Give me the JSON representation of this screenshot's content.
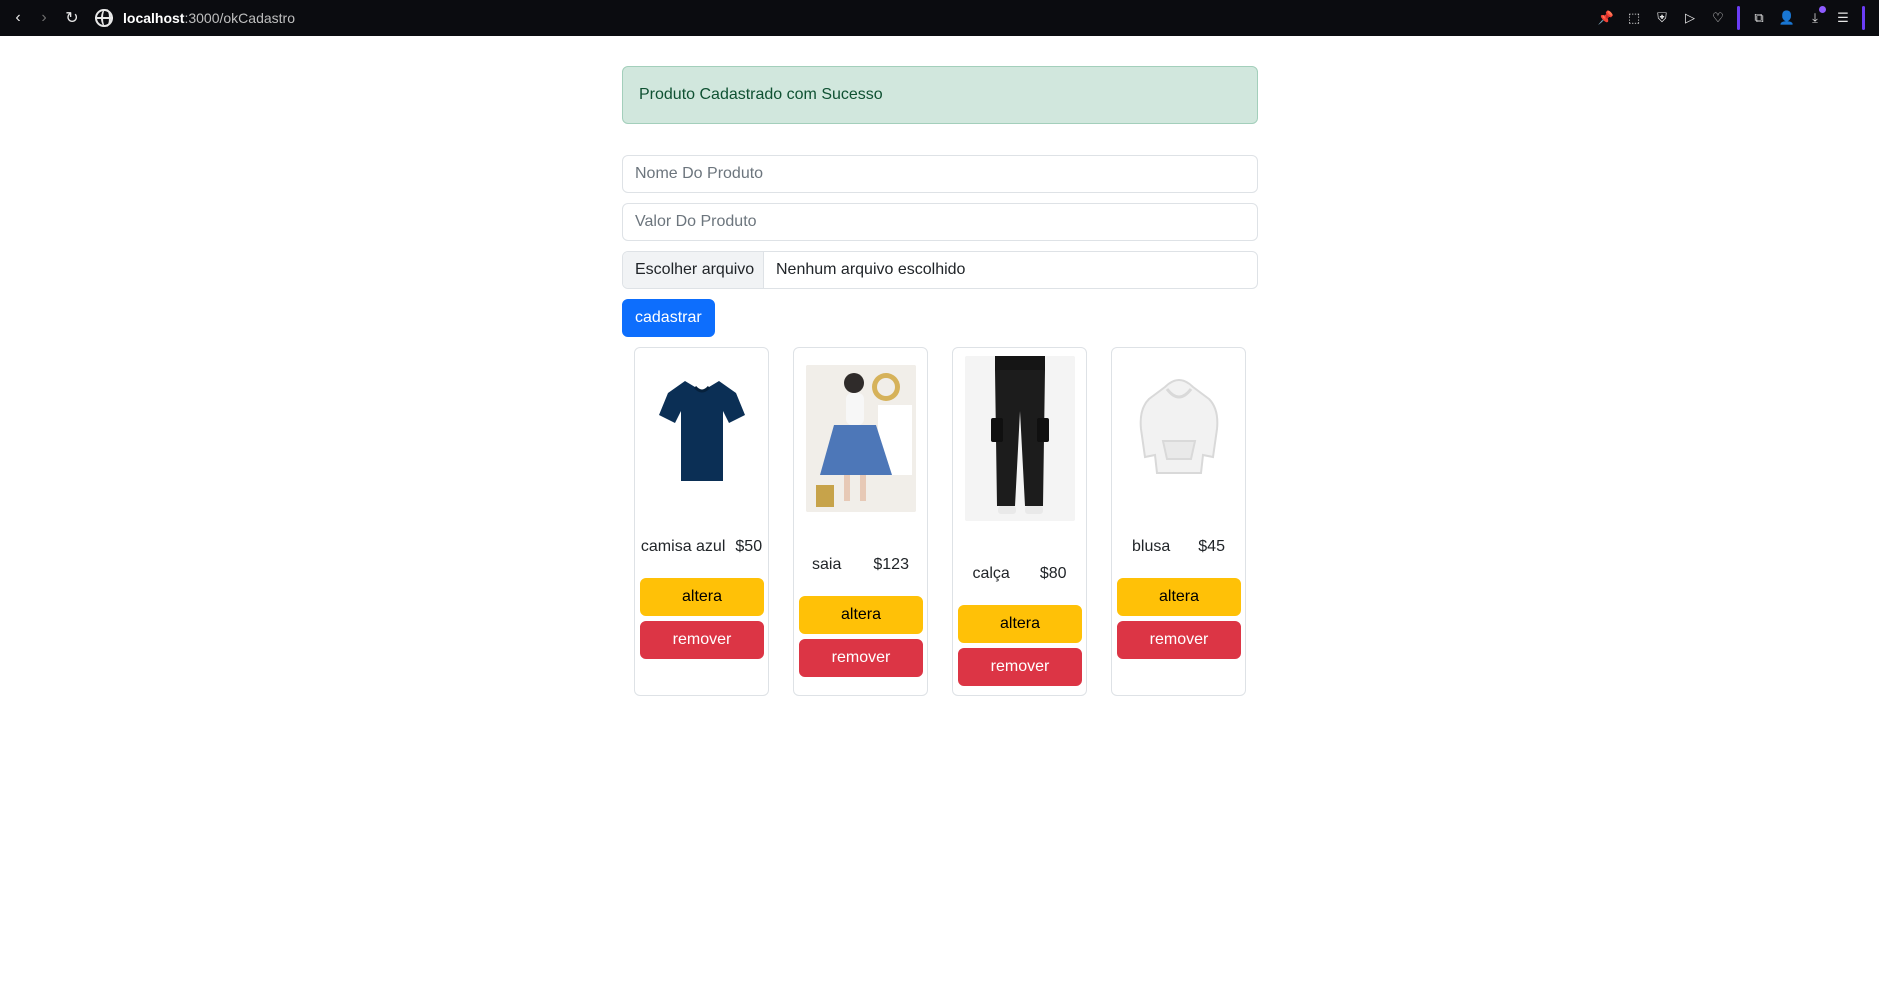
{
  "browser": {
    "url_host": "localhost",
    "url_rest": ":3000/okCadastro"
  },
  "alert": {
    "message": "Produto Cadastrado com Sucesso"
  },
  "form": {
    "name_placeholder": "Nome Do Produto",
    "value_placeholder": "Valor Do Produto",
    "file_button_label": "Escolher arquivo",
    "file_status": "Nenhum arquivo escolhido",
    "submit_label": "cadastrar"
  },
  "products": [
    {
      "name": "camisa azul",
      "price": "$50",
      "alter_label": "altera",
      "remove_label": "remover",
      "image_icon": "tshirt-icon",
      "colors": {
        "main": "#0b2f55",
        "shadow": "#06213c"
      }
    },
    {
      "name": "saia",
      "price": "$123",
      "alter_label": "altera",
      "remove_label": "remover",
      "image_icon": "skirt-photo",
      "colors": {
        "main": "#4d77b8",
        "accent": "#f0f0f0"
      }
    },
    {
      "name": "calça",
      "price": "$80",
      "alter_label": "altera",
      "remove_label": "remover",
      "image_icon": "pants-photo",
      "colors": {
        "main": "#1c1c1c",
        "accent": "#e9e9e9"
      }
    },
    {
      "name": "blusa",
      "price": "$45",
      "alter_label": "altera",
      "remove_label": "remover",
      "image_icon": "hoodie-icon",
      "colors": {
        "main": "#f2f2f2",
        "shadow": "#d9d9d9"
      }
    }
  ],
  "theme": {
    "primary": "#0d6efd",
    "warning": "#ffc107",
    "danger": "#dc3545",
    "success_bg": "#d1e7dd",
    "success_border": "#a3cfbb",
    "success_text": "#0f5132"
  }
}
